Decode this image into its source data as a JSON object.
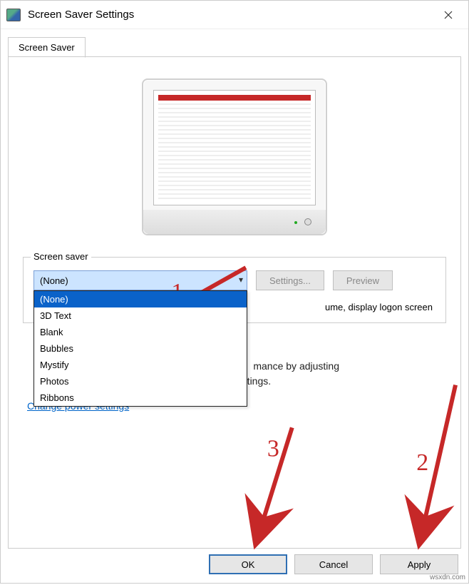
{
  "window": {
    "title": "Screen Saver Settings"
  },
  "tab": {
    "label": "Screen Saver"
  },
  "group": {
    "label": "Screen saver",
    "combo_selected": "(None)",
    "options": [
      "(None)",
      "3D Text",
      "Blank",
      "Bubbles",
      "Mystify",
      "Photos",
      "Ribbons"
    ],
    "settings_btn": "Settings...",
    "preview_btn": "Preview",
    "resume_tail": "ume, display logon screen"
  },
  "pm": {
    "line1_tail": "mance by adjusting",
    "line2_tail": "settings.",
    "link": "Change power settings"
  },
  "buttons": {
    "ok": "OK",
    "cancel": "Cancel",
    "apply": "Apply"
  },
  "annotations": {
    "n1": "1",
    "n2": "2",
    "n3": "3"
  },
  "watermark": "wsxdn.com"
}
